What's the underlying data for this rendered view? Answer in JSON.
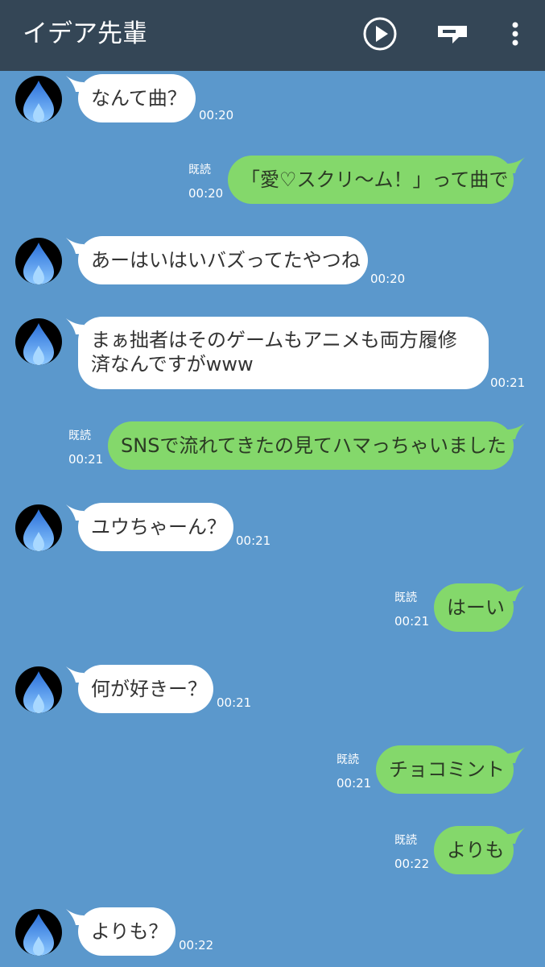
{
  "header": {
    "title": "イデア先輩",
    "icons": [
      "play-circle-icon",
      "note-icon",
      "more-vert-icon"
    ]
  },
  "colors": {
    "header_bg": "#344656",
    "chat_bg": "#5b98cc",
    "incoming_bubble": "#ffffff",
    "outgoing_bubble": "#84d86b"
  },
  "messages": [
    {
      "text": "なんて曲？",
      "time": "00:20"
    },
    {
      "text": "「愛♡スクリ〜ム！」って曲で",
      "time": "00:20",
      "read": "既読"
    },
    {
      "text": "あーはいはいバズってたやつね",
      "time": "00:20"
    },
    {
      "text": "まぁ拙者はそのゲームもアニメも両方履修済なんですがwww",
      "time": "00:21"
    },
    {
      "text": "SNSで流れてきたの見てハマっちゃいました",
      "time": "00:21",
      "read": "既読"
    },
    {
      "text": "ユウちゃーん？",
      "time": "00:21"
    },
    {
      "text": "はーい",
      "time": "00:21",
      "read": "既読"
    },
    {
      "text": "何が好きー？",
      "time": "00:21"
    },
    {
      "text": "チョコミント",
      "time": "00:21",
      "read": "既読"
    },
    {
      "text": "よりも",
      "time": "00:22",
      "read": "既読"
    },
    {
      "text": "よりも？",
      "time": "00:22"
    }
  ]
}
